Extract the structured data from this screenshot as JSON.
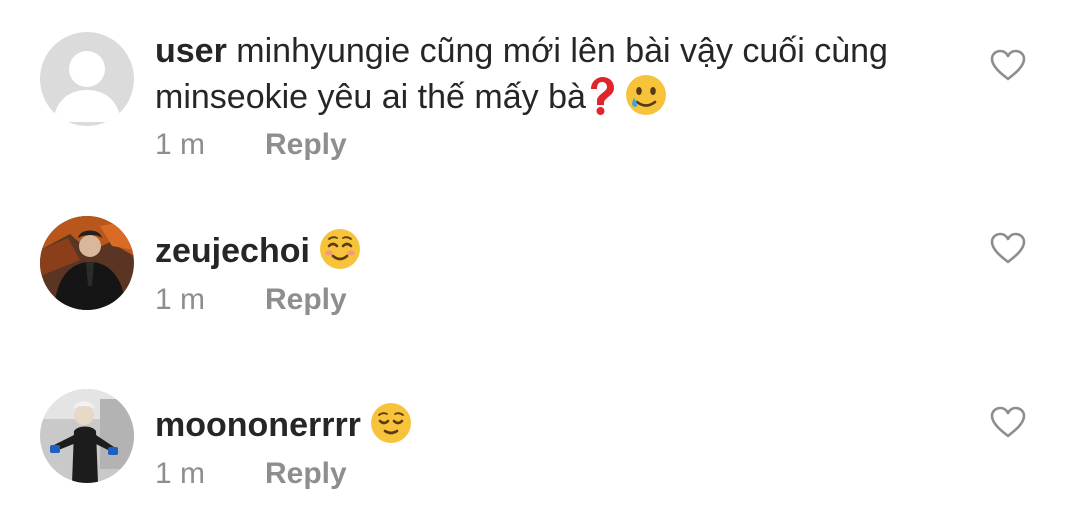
{
  "comments": [
    {
      "username": "user",
      "text": "minhyungie cũng mới lên bài vậy cuối cùng minseokie yêu ai thế mấy bà",
      "emojis": [
        "red-question-mark",
        "smiling-face-with-tear"
      ],
      "time": "1 m",
      "reply_label": "Reply",
      "avatar": "default-avatar"
    },
    {
      "username": "zeujechoi",
      "text": "",
      "emojis": [
        "smiling-face"
      ],
      "time": "1 m",
      "reply_label": "Reply",
      "avatar": "profile-photo"
    },
    {
      "username": "moononerrrr",
      "text": "",
      "emojis": [
        "relieved-face"
      ],
      "time": "1 m",
      "reply_label": "Reply",
      "avatar": "profile-photo"
    }
  ],
  "colors": {
    "primary_text": "#262626",
    "secondary_text": "#8e8e8e",
    "default_avatar_bg": "#dbdbdb",
    "emoji_yellow": "#f6c33b"
  },
  "icons": {
    "like": "heart-outline-icon"
  }
}
